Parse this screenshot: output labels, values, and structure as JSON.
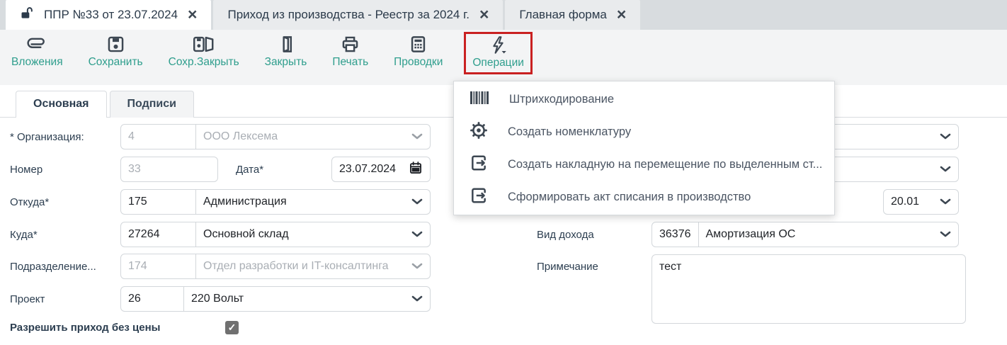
{
  "glyphs": {
    "close": "×",
    "check": "✓"
  },
  "colors": {
    "accent_teal": "#2f9e8d",
    "icon_gray": "#3d4752",
    "highlight_red": "#c92121",
    "tabbar_bg": "#d8dcdf"
  },
  "window_tabs": [
    {
      "label": "ППР №33 от 23.07.2024",
      "active": true,
      "icon": "unlock-icon"
    },
    {
      "label": "Приход из производства - Реестр за 2024 г.",
      "active": false
    },
    {
      "label": "Главная форма",
      "active": false
    }
  ],
  "toolbar": {
    "items": [
      {
        "label": "Вложения",
        "icon": "paperclip-icon"
      },
      {
        "label": "Сохранить",
        "icon": "save-icon"
      },
      {
        "label": "Сохр.Закрыть",
        "icon": "save-close-icon"
      },
      {
        "label": "Закрыть",
        "icon": "door-icon"
      },
      {
        "label": "Печать",
        "icon": "printer-icon"
      },
      {
        "label": "Проводки",
        "icon": "calculator-icon"
      },
      {
        "label": "Операции",
        "icon": "lightning-icon",
        "highlighted": true
      }
    ]
  },
  "form_tabs": [
    {
      "label": "Основная",
      "active": true
    },
    {
      "label": "Подписи",
      "active": false
    }
  ],
  "form": {
    "organization": {
      "label": "* Организация:",
      "code": "4",
      "name": "ООО Лексема",
      "disabled": true
    },
    "number": {
      "label": "Номер",
      "value": "33",
      "disabled": true
    },
    "date": {
      "label": "Дата*",
      "value": "23.07.2024"
    },
    "from": {
      "label": "Откуда*",
      "code": "175",
      "name": "Администрация"
    },
    "to": {
      "label": "Куда*",
      "code": "27264",
      "name": "Основной склад"
    },
    "department": {
      "label": "Подразделение...",
      "code": "174",
      "name": "Отдел разработки и IT-консалтинга",
      "disabled": true
    },
    "project": {
      "label": "Проект",
      "code": "26",
      "name": "220 Вольт"
    },
    "allow_no_price": {
      "label": "Разрешить приход без цены",
      "checked": true
    },
    "account": {
      "value": "20.01"
    },
    "income_type": {
      "label": "Вид дохода",
      "code": "36376",
      "name": "Амортизация ОС"
    },
    "note": {
      "label": "Примечание",
      "value": "тест"
    }
  },
  "operations_menu": {
    "items": [
      {
        "icon": "barcode-icon",
        "label": "Штрихкодирование"
      },
      {
        "icon": "gear-icon",
        "label": "Создать номенклатуру"
      },
      {
        "icon": "transfer-icon",
        "label": "Создать накладную на перемещение по выделенным ст..."
      },
      {
        "icon": "transfer-icon",
        "label": "Сформировать акт списания в производство"
      }
    ]
  }
}
